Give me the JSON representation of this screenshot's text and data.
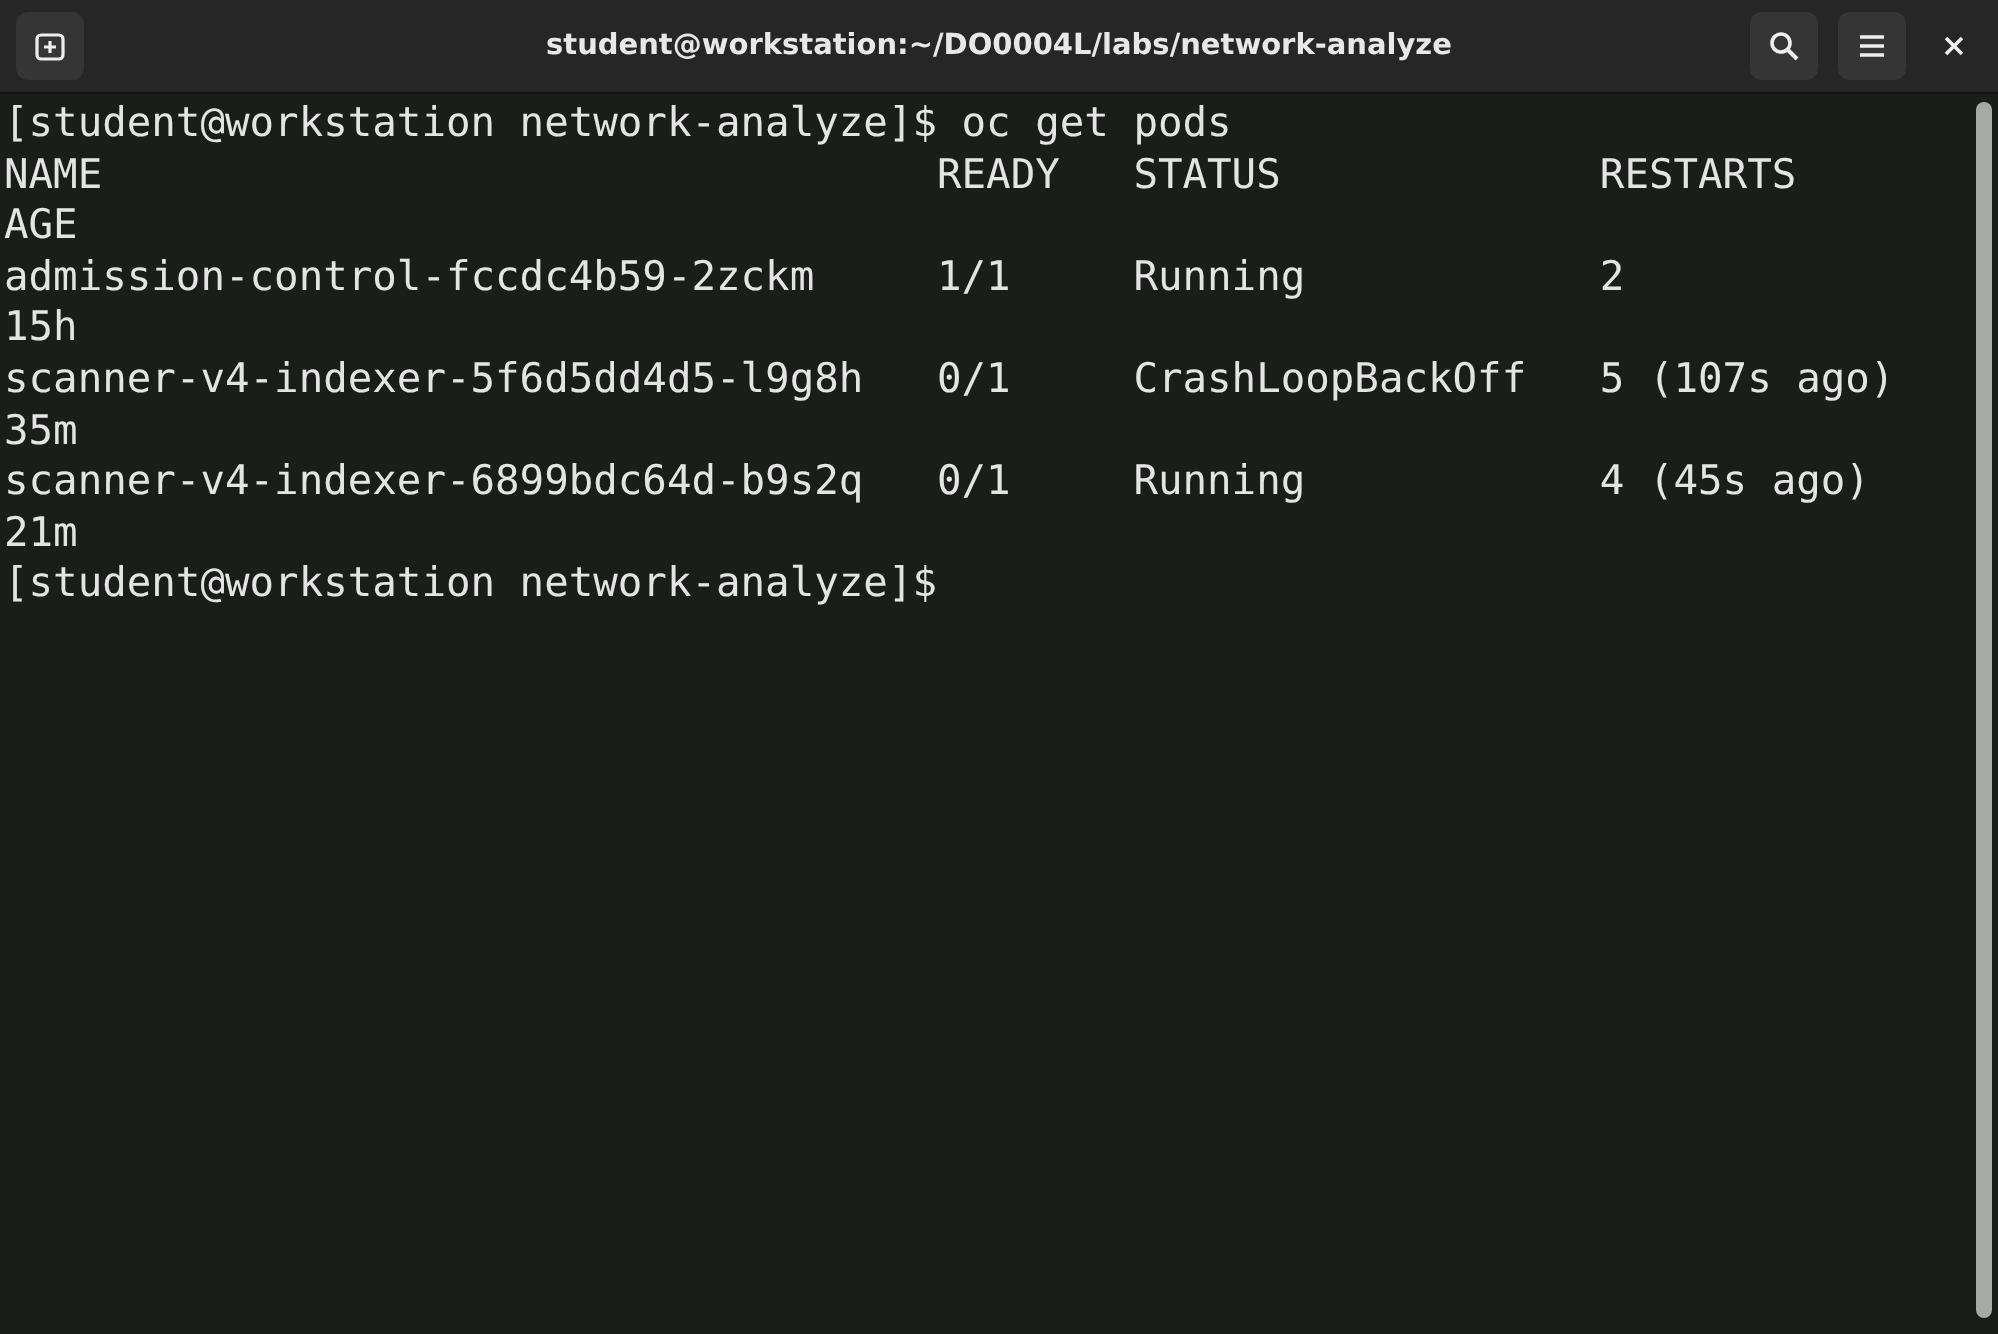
{
  "window": {
    "title": "student@workstation:~/DO0004L/labs/network-analyze"
  },
  "terminal": {
    "command_line": {
      "prompt": "[student@workstation network-analyze]$",
      "command": "oc get pods"
    },
    "table": {
      "columns": [
        "NAME",
        "READY",
        "STATUS",
        "RESTARTS",
        "AGE"
      ],
      "rows": [
        {
          "name": "admission-control-fccdc4b59-2zckm",
          "ready": "1/1",
          "status": "Running",
          "restarts": "2",
          "age": "15h"
        },
        {
          "name": "scanner-v4-indexer-5f6d5dd4d5-l9g8h",
          "ready": "0/1",
          "status": "CrashLoopBackOff",
          "restarts": "5 (107s ago)",
          "age": "35m"
        },
        {
          "name": "scanner-v4-indexer-6899bdc64d-b9s2q",
          "ready": "0/1",
          "status": "Running",
          "restarts": "4 (45s ago)",
          "age": "21m"
        }
      ]
    },
    "last_prompt": "[student@workstation network-analyze]$"
  }
}
